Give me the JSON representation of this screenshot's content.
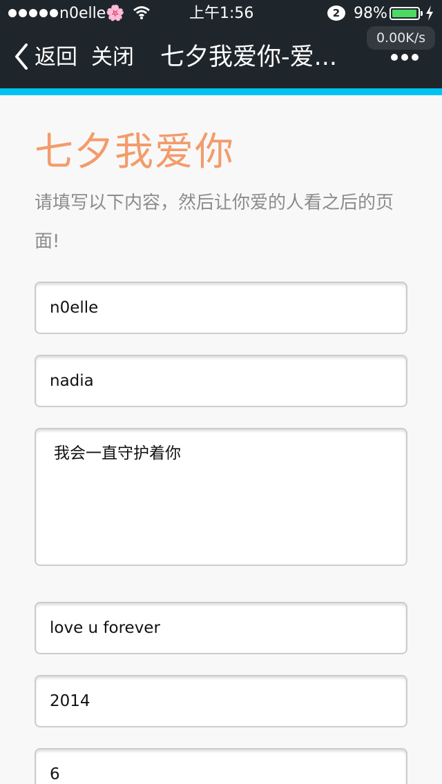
{
  "status_bar": {
    "carrier": "n0elle🌸",
    "time": "上午1:56",
    "notification_count": "2",
    "battery_percent": "98%",
    "battery_level": 0.98,
    "network_speed": "0.00K/s"
  },
  "nav": {
    "back_label": "返回",
    "close_label": "关闭",
    "title": "七夕我爱你-爱..."
  },
  "colors": {
    "nav_bg": "#1f262b",
    "accent_bar": "#00c3f3",
    "title_orange": "#f39b6b",
    "battery_green": "#4cd964"
  },
  "page": {
    "title": "七夕我爱你",
    "subtitle": "请填写以下内容，然后让你爱的人看之后的页面!"
  },
  "form": {
    "fields": [
      {
        "value": "n0elle"
      },
      {
        "value": "nadia"
      },
      {
        "value": "我会一直守护着你"
      },
      {
        "value": "love u forever"
      },
      {
        "value": "2014"
      },
      {
        "value": "6"
      }
    ]
  }
}
